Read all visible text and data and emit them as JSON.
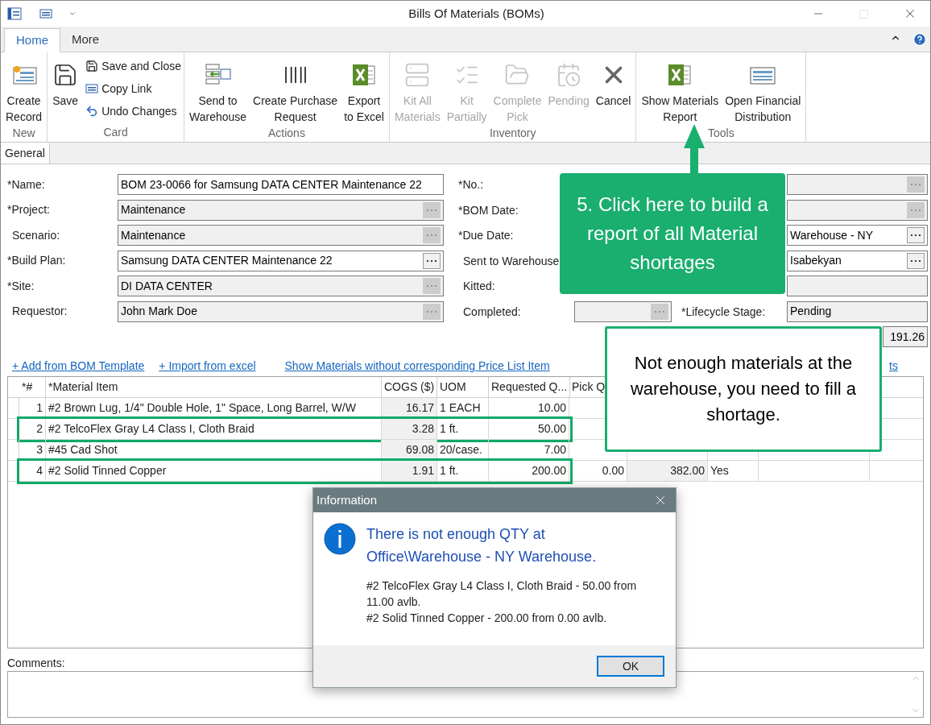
{
  "window": {
    "title": "Bills Of Materials (BOMs)"
  },
  "ribbon": {
    "tabs": [
      {
        "label": "Home",
        "selected": true
      },
      {
        "label": "More",
        "selected": false
      }
    ],
    "groups": [
      {
        "label": "New",
        "items": [
          {
            "kind": "large",
            "label": "Create\nRecord",
            "disabled": false
          }
        ]
      },
      {
        "label": "Card",
        "items": [
          {
            "kind": "large",
            "label": "Save",
            "disabled": false
          },
          {
            "kind": "small",
            "label": "Save and Close",
            "disabled": false
          },
          {
            "kind": "small",
            "label": "Copy Link",
            "disabled": false
          },
          {
            "kind": "small",
            "label": "Undo Changes",
            "disabled": false
          }
        ]
      },
      {
        "label": "Actions",
        "items": [
          {
            "kind": "large",
            "label": "Send to\nWarehouse",
            "disabled": false
          },
          {
            "kind": "large",
            "label": "Create Purchase\nRequest",
            "disabled": false
          },
          {
            "kind": "large",
            "label": "Export\nto Excel",
            "disabled": false
          }
        ]
      },
      {
        "label": "Inventory",
        "items": [
          {
            "kind": "large",
            "label": "Kit All\nMaterials",
            "disabled": true
          },
          {
            "kind": "large",
            "label": "Kit\nPartially",
            "disabled": true
          },
          {
            "kind": "large",
            "label": "Complete\nPick",
            "disabled": true
          },
          {
            "kind": "large",
            "label": "Pending",
            "disabled": true
          },
          {
            "kind": "large",
            "label": "Cancel",
            "disabled": false
          }
        ]
      },
      {
        "label": "Tools",
        "items": [
          {
            "kind": "large",
            "label": "Show Materials\nReport",
            "disabled": false
          },
          {
            "kind": "large",
            "label": "Open Financial\nDistribution",
            "disabled": false
          }
        ]
      }
    ]
  },
  "form": {
    "tab": {
      "label": "General",
      "selected": true
    },
    "left_fields": [
      {
        "label": "*Name:",
        "required": true,
        "kind": "text",
        "disabled": false,
        "value": "BOM 23-0066 for Samsung DATA CENTER Maintenance 22"
      },
      {
        "label": "*Project:",
        "required": true,
        "kind": "lookup",
        "disabled": true,
        "value": "Maintenance"
      },
      {
        "label": "Scenario:",
        "required": false,
        "kind": "lookup",
        "disabled": true,
        "value": "Maintenance"
      },
      {
        "label": "*Build Plan:",
        "required": true,
        "kind": "lookup",
        "disabled": false,
        "value": "Samsung DATA CENTER Maintenance 22"
      },
      {
        "label": "*Site:",
        "required": true,
        "kind": "lookup",
        "disabled": true,
        "value": "DI DATA CENTER"
      },
      {
        "label": "Requestor:",
        "required": false,
        "kind": "lookup",
        "disabled": true,
        "value": "John Mark Doe"
      }
    ],
    "middle_fields": [
      {
        "label": "*No.:",
        "required": true
      },
      {
        "label": "*BOM Date:",
        "required": true
      },
      {
        "label": "*Due Date:",
        "required": true
      },
      {
        "label": "Sent to Warehouse",
        "required": false
      },
      {
        "label": "Kitted:",
        "required": false
      },
      {
        "label": "Completed:",
        "required": false,
        "kind": "lookup",
        "disabled": true
      }
    ],
    "right_fields": [
      {
        "kind": "lookup",
        "disabled": true
      },
      {
        "kind": "lookup",
        "disabled": true
      },
      {
        "kind": "lookup",
        "disabled": false,
        "value": "Warehouse - NY"
      },
      {
        "kind": "lookup",
        "disabled": false,
        "value": "Isabekyan"
      },
      {
        "kind": "text",
        "disabled": true
      },
      {
        "label": "*Lifecycle Stage:",
        "kind": "text",
        "disabled": true,
        "value": "Pending"
      },
      {
        "kind": "text",
        "disabled": true,
        "value": "191.26"
      }
    ]
  },
  "links": [
    "+ Add from BOM Template",
    "+ Import from excel",
    "Show Materials without corresponding Price List Item",
    "ts"
  ],
  "table": {
    "columns": [
      "*#",
      "*Material Item",
      "COGS ($)",
      "UOM",
      "Requested Q...",
      "Pick Q"
    ],
    "rows": [
      {
        "cells": [
          "1",
          "#2 Brown Lug, 1/4\" Double Hole, 1\" Space, Long Barrel, W/W",
          "16.17",
          "1 EACH",
          "10.00"
        ],
        "highlighted": false
      },
      {
        "cells": [
          "2",
          "#2 TelcoFlex Gray L4 Class I, Cloth Braid",
          "3.28",
          "1 ft.",
          "50.00"
        ],
        "highlighted": true
      },
      {
        "cells": [
          "3",
          "#45 Cad Shot",
          "69.08",
          "20/case.",
          "7.00"
        ],
        "highlighted": false
      },
      {
        "cells": [
          "4",
          "#2 Solid Tinned Copper",
          "1.91",
          "1 ft.",
          "200.00",
          "0.00",
          "382.00",
          "Yes"
        ],
        "highlighted": true
      }
    ]
  },
  "comments": {
    "label": "Comments:"
  },
  "callouts": [
    {
      "kind": "filled",
      "text": "5. Click here to build a report of all Material shortages"
    },
    {
      "kind": "outlined",
      "text": "Not enough materials at the warehouse, you need to fill a shortage."
    }
  ],
  "dialog": {
    "title": "Information",
    "heading": "There is not enough QTY at Office\\Warehouse - NY Warehouse.",
    "lines": [
      "#2 TelcoFlex Gray L4 Class I, Cloth Braid - 50.00 from 11.00 avlb.",
      "#2 Solid Tinned Copper - 200.00 from 0.00 avlb."
    ],
    "button": "OK"
  }
}
